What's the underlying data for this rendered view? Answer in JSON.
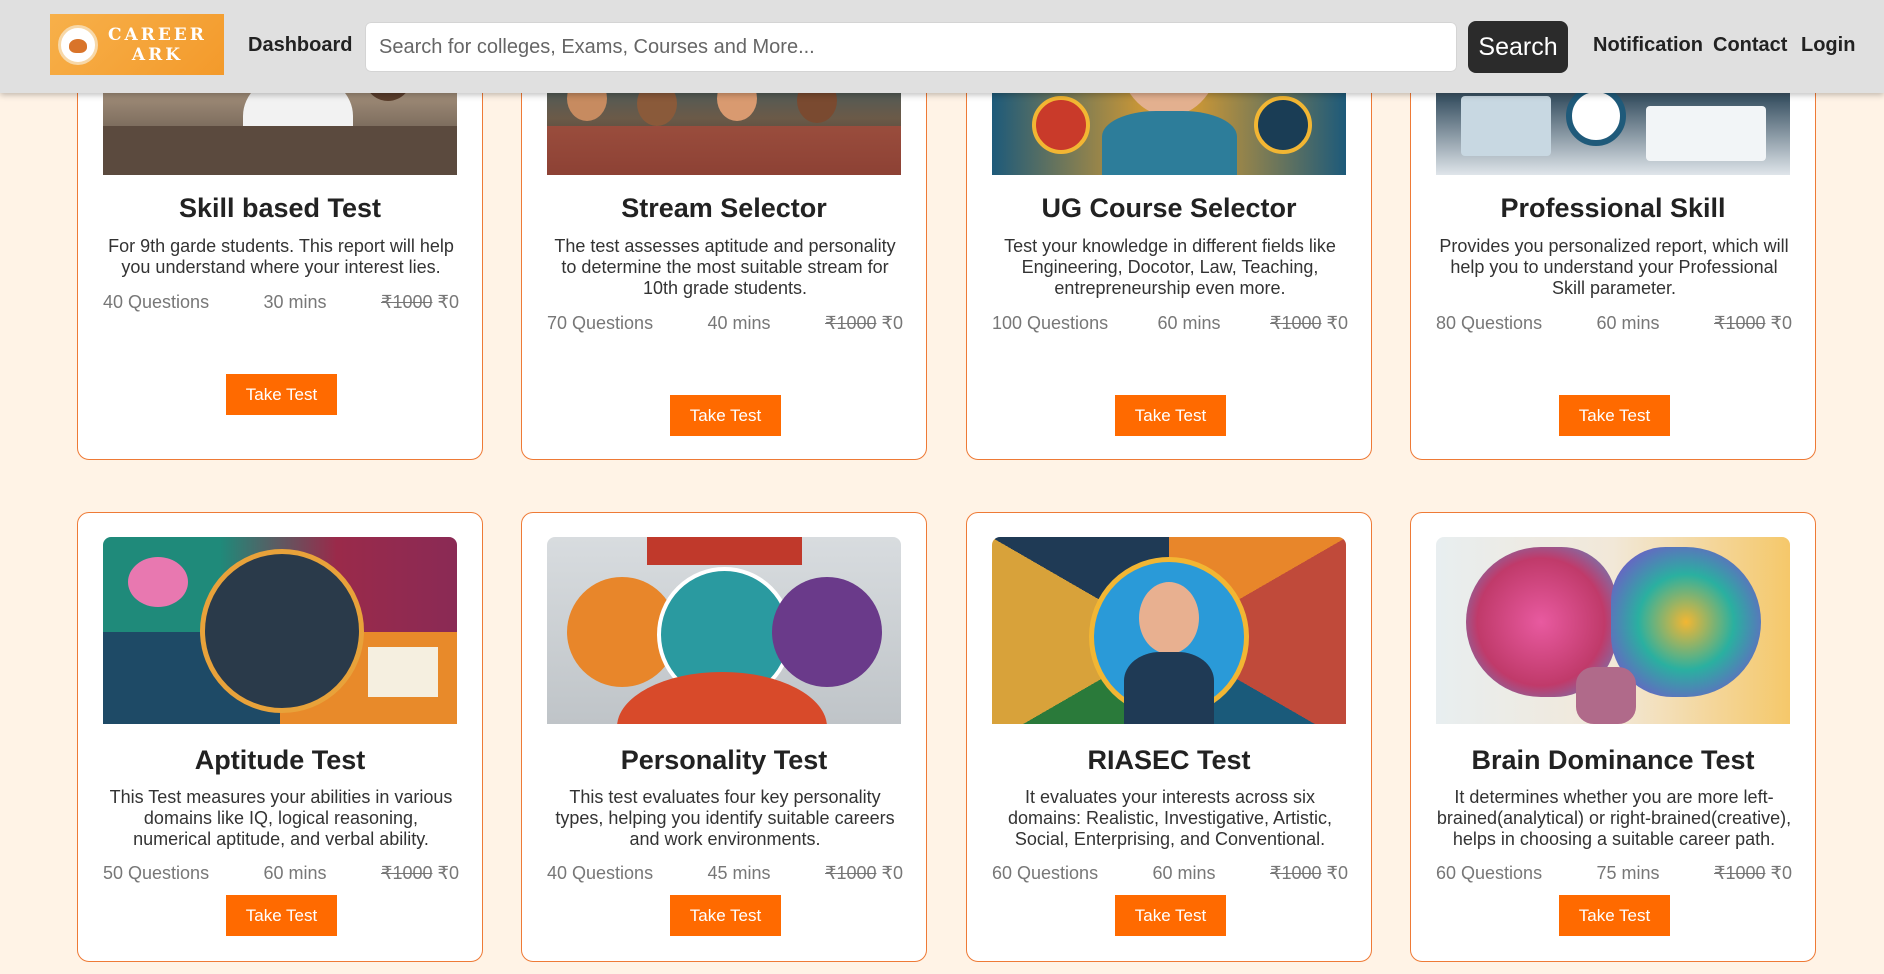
{
  "header": {
    "logo_text_line1": "CAREER",
    "logo_text_line2": "ARK",
    "nav": {
      "dashboard": "Dashboard",
      "notification": "Notification",
      "contact": "Contact",
      "login": "Login"
    },
    "search": {
      "placeholder": "Search for colleges, Exams, Courses and More...",
      "button_label": "Search"
    }
  },
  "colors": {
    "accent": "#ff6a00",
    "card_border": "#ee7a36",
    "page_bg": "#fff3e6",
    "header_bg": "#e0e0e0"
  },
  "cards": [
    {
      "title": "Skill based Test",
      "description": "For 9th garde students. This report will help you understand where your interest lies.",
      "questions": "40 Questions",
      "duration": "30 mins",
      "price_old": "₹1000",
      "price_new": "₹0",
      "button": "Take Test"
    },
    {
      "title": "Stream Selector",
      "description": "The test assesses aptitude and personality to determine the most suitable stream for 10th grade students.",
      "questions": "70 Questions",
      "duration": "40 mins",
      "price_old": "₹1000",
      "price_new": "₹0",
      "button": "Take Test"
    },
    {
      "title": "UG Course Selector",
      "description": "Test your knowledge in different fields like Engineering, Docotor, Law, Teaching, entrepreneurship even more.",
      "questions": "100 Questions",
      "duration": "60 mins",
      "price_old": "₹1000",
      "price_new": "₹0",
      "button": "Take Test"
    },
    {
      "title": "Professional Skill",
      "description": "Provides you personalized report, which will help you to understand your Professional Skill parameter.",
      "questions": "80 Questions",
      "duration": "60 mins",
      "price_old": "₹1000",
      "price_new": "₹0",
      "button": "Take Test"
    },
    {
      "title": "Aptitude Test",
      "description": "This Test measures your abilities in various domains like IQ, logical reasoning, numerical aptitude, and verbal ability.",
      "questions": "50 Questions",
      "duration": "60 mins",
      "price_old": "₹1000",
      "price_new": "₹0",
      "button": "Take Test"
    },
    {
      "title": "Personality Test",
      "description": "This test evaluates four key personality types, helping you identify suitable careers and work environments.",
      "questions": "40 Questions",
      "duration": "45 mins",
      "price_old": "₹1000",
      "price_new": "₹0",
      "button": "Take Test"
    },
    {
      "title": "RIASEC Test",
      "description": "It evaluates your interests across six domains: Realistic, Investigative, Artistic, Social, Enterprising, and Conventional.",
      "questions": "60 Questions",
      "duration": "60 mins",
      "price_old": "₹1000",
      "price_new": "₹0",
      "button": "Take Test"
    },
    {
      "title": "Brain Dominance Test",
      "description": "It determines whether you are more left-brained(analytical) or right-brained(creative), helps in choosing a suitable career path.",
      "questions": "60 Questions",
      "duration": "75 mins",
      "price_old": "₹1000",
      "price_new": "₹0",
      "button": "Take Test"
    }
  ]
}
